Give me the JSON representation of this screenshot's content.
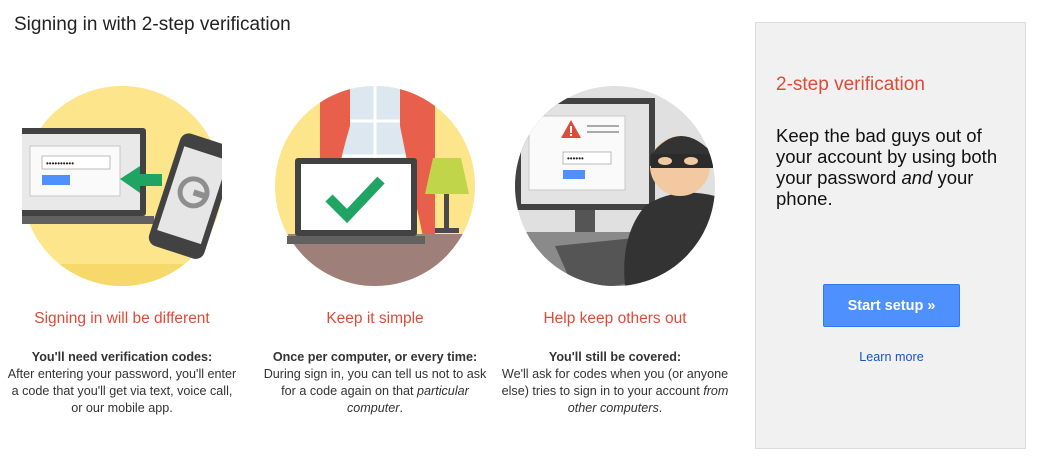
{
  "page_title": "Signing in with 2-step verification",
  "features": [
    {
      "title": "Signing in will be different",
      "body_strong": "You'll need verification codes:",
      "body_1": "After entering your password, you'll enter a code that you'll get via text, voice call, or our mobile app.",
      "body_italic": "",
      "body_2": "",
      "illustration": "laptop-phone-code-illustration"
    },
    {
      "title": "Keep it simple",
      "body_strong": "Once per computer, or every time:",
      "body_1": "During sign in, you can tell us not to ask for a code again on that ",
      "body_italic": "particular computer",
      "body_2": ".",
      "illustration": "laptop-checkmark-illustration"
    },
    {
      "title": "Help keep others out",
      "body_strong": "You'll still be covered:",
      "body_1": "We'll ask for codes when you (or anyone else) tries to sign in to your account ",
      "body_italic": "from other computers",
      "body_2": ".",
      "illustration": "thief-computer-illustration"
    }
  ],
  "sidebar": {
    "title": "2-step verification",
    "text_1": "Keep the bad guys out of your account by using both your password ",
    "text_italic": "and",
    "text_2": " your phone.",
    "start_button": "Start setup »",
    "learn_more": "Learn more"
  },
  "password_mask": "••••••••••",
  "password_mask_short": "••••••",
  "colors": {
    "accent_red": "#dd4b39",
    "button_blue": "#4d90fe",
    "link_blue": "#1155cc",
    "circle_yellow": "#fce58a",
    "check_green": "#1fa463"
  }
}
